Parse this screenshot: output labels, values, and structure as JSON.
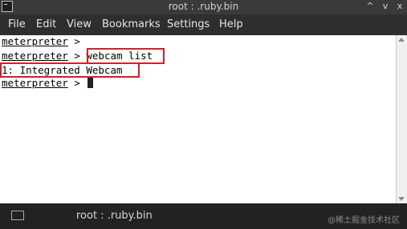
{
  "window": {
    "title": "root : .ruby.bin",
    "controls": [
      "^",
      "v",
      "x"
    ]
  },
  "menubar": {
    "items": [
      "File",
      "Edit",
      "View",
      "Bookmarks",
      "Settings",
      "Help"
    ]
  },
  "terminal": {
    "lines": [
      {
        "prompt": "meterpreter",
        "sep": " > ",
        "command": ""
      },
      {
        "prompt": "meterpreter",
        "sep": " > ",
        "command": "webcam list"
      },
      {
        "output": "1: Integrated Webcam"
      },
      {
        "prompt": "meterpreter",
        "sep": " > ",
        "command": ""
      }
    ],
    "highlight_color": "#d0202a"
  },
  "taskbar": {
    "label": "root : .ruby.bin",
    "watermark": "@稀土掘金技术社区"
  }
}
